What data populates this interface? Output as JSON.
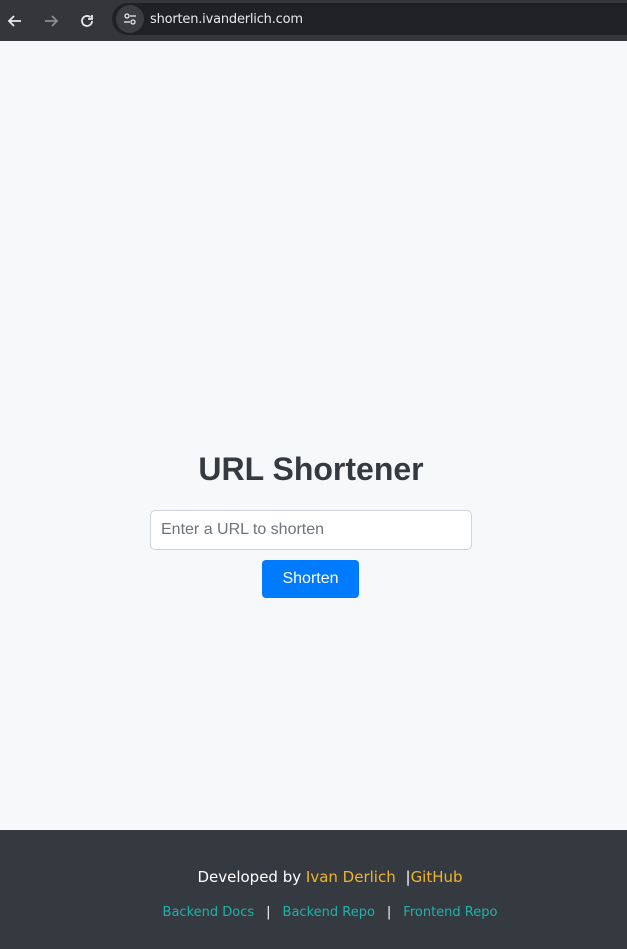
{
  "browser": {
    "url": "shorten.ivanderlich.com",
    "icons": {
      "back": "arrow-left-icon",
      "forward": "arrow-right-icon",
      "reload": "reload-icon",
      "site_info": "site-settings-icon"
    }
  },
  "main": {
    "title": "URL Shortener",
    "input_placeholder": "Enter a URL to shorten",
    "input_value": "",
    "button_label": "Shorten"
  },
  "footer": {
    "developed_by": "Developed by",
    "author": "Ivan Derlich",
    "separator": "|",
    "github": "GitHub",
    "links": [
      {
        "label": "Backend Docs"
      },
      {
        "label": "Backend Repo"
      },
      {
        "label": "Frontend Repo"
      }
    ]
  },
  "colors": {
    "primary_button": "#007bff",
    "accent_yellow": "#f0b429",
    "link_teal": "#20b2aa",
    "footer_bg": "#343a40",
    "page_bg": "#f7f8fa"
  }
}
